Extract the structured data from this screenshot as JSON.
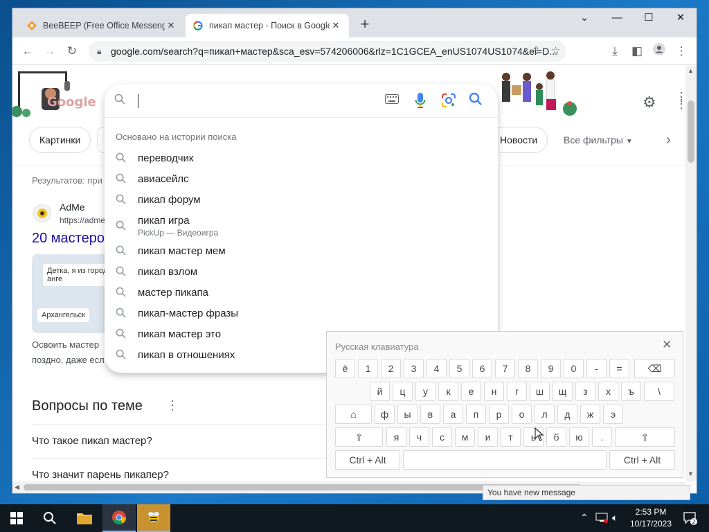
{
  "browser": {
    "tabs": [
      {
        "title": "BeeBEEP (Free Office Messenger)",
        "close": "✕"
      },
      {
        "title": "пикап мастер - Поиск в Google",
        "close": "✕"
      }
    ],
    "new_tab": "+",
    "url": "google.com/search?q=пикап+мастер&sca_esv=574206006&rlz=1C1GCEA_enUS1074US1074&ei=D...",
    "window_controls": {
      "minimize": "—",
      "maximize": "☐",
      "close": "✕"
    }
  },
  "search_chips": {
    "images": "Картинки",
    "news": "Новости",
    "all_filters": "Все фильтры"
  },
  "results": {
    "count_text": "Результатов: при",
    "site_name": "AdMe",
    "site_url": "https://adme",
    "title": "20 мастеро",
    "thumb_text_1": "Детка, я из города анге",
    "thumb_text_2": "Архангельск",
    "snippet_1": "Освоить мастер",
    "snippet_2": "поздно, даже есл"
  },
  "people_also_ask": {
    "title": "Вопросы по теме",
    "questions": [
      "Что такое пикап мастер?",
      "Что значит парень пикапер?"
    ]
  },
  "suggestions": {
    "header": "Основано на истории поиска",
    "items": [
      {
        "label": "переводчик",
        "sub": ""
      },
      {
        "label": "авиасейлс",
        "sub": ""
      },
      {
        "label": "пикап форум",
        "sub": ""
      },
      {
        "label": "пикап игра",
        "sub": "PickUp — Видеоигра"
      },
      {
        "label": "пикап мастер мем",
        "sub": ""
      },
      {
        "label": "пикап взлом",
        "sub": ""
      },
      {
        "label": "мастер пикапа",
        "sub": ""
      },
      {
        "label": "пикап-мастер фразы",
        "sub": ""
      },
      {
        "label": "пикап мастер это",
        "sub": ""
      },
      {
        "label": "пикап в отношениях",
        "sub": ""
      }
    ]
  },
  "keyboard": {
    "title": "Русская клавиатура",
    "close": "✕",
    "row1": [
      "ё",
      "1",
      "2",
      "3",
      "4",
      "5",
      "6",
      "7",
      "8",
      "9",
      "0",
      "-",
      "="
    ],
    "row2": [
      "й",
      "ц",
      "у",
      "к",
      "е",
      "н",
      "г",
      "ш",
      "щ",
      "з",
      "х",
      "ъ",
      "\\"
    ],
    "row3": [
      "ф",
      "ы",
      "в",
      "а",
      "п",
      "р",
      "о",
      "л",
      "д",
      "ж",
      "э"
    ],
    "row4": [
      "я",
      "ч",
      "с",
      "м",
      "и",
      "т",
      "ь",
      "б",
      "ю",
      "."
    ],
    "ctrl_alt_left": "Ctrl + Alt",
    "ctrl_alt_right": "Ctrl + Alt"
  },
  "notification": {
    "text": "You have new message"
  },
  "taskbar": {
    "clock_time": "2:53 PM",
    "clock_date": "10/17/2023",
    "notification_count": "2"
  },
  "colors": {
    "accent": "#1a73e8",
    "link": "#1a0dab",
    "taskbar": "#101820"
  }
}
